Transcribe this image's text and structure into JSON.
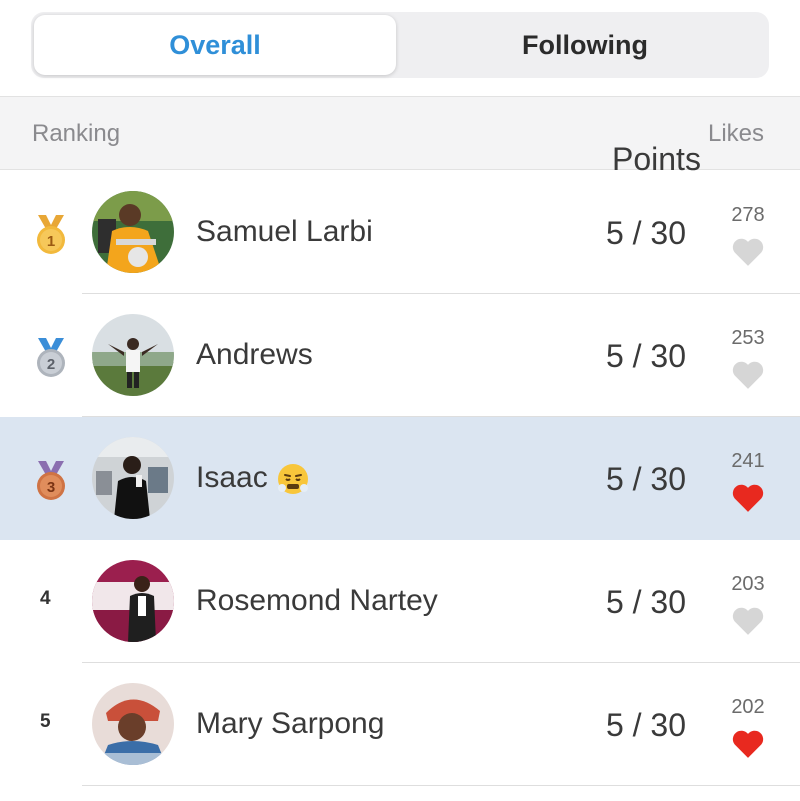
{
  "tabs": [
    {
      "label": "Overall",
      "active": true
    },
    {
      "label": "Following",
      "active": false
    }
  ],
  "table_header": {
    "ranking": "Ranking",
    "points": "Points",
    "likes": "Likes"
  },
  "rows": [
    {
      "rank": "1",
      "medal": "gold",
      "name": "Samuel Larbi",
      "points": "5 / 30",
      "likes": "278",
      "liked": false,
      "avatar": "avatar-photo"
    },
    {
      "rank": "2",
      "medal": "silver",
      "name": "Andrews",
      "points": "5 / 30",
      "likes": "253",
      "liked": false,
      "avatar": "avatar-photo"
    },
    {
      "rank": "3",
      "medal": "bronze",
      "name": "Isaac",
      "name_emoji": "steam-from-nose-emoji",
      "points": "5 / 30",
      "likes": "241",
      "liked": true,
      "avatar": "avatar-photo",
      "highlighted": true
    },
    {
      "rank": "4",
      "medal": null,
      "name": "Rosemond Nartey",
      "points": "5 / 30",
      "likes": "203",
      "liked": false,
      "avatar": "avatar-photo"
    },
    {
      "rank": "5",
      "medal": null,
      "name": "Mary Sarpong",
      "points": "5 / 30",
      "likes": "202",
      "liked": true,
      "avatar": "avatar-photo"
    }
  ],
  "colors": {
    "accent": "#2f8fd8",
    "highlight_row": "#dbe5f1",
    "heart_liked": "#e8291f",
    "heart_unliked": "#d6d6d6",
    "gold": "#f2b93c",
    "silver": "#b9bec6",
    "bronze": "#d9824f"
  }
}
